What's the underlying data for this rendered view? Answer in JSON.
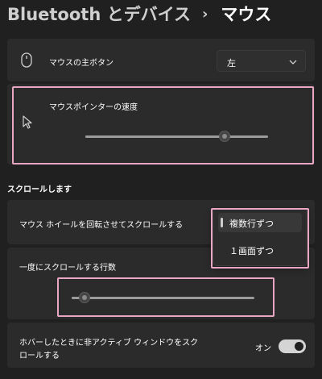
{
  "breadcrumb": {
    "root": "Bluetooth とデバイス",
    "separator": "›",
    "current": "マウス"
  },
  "primary_button": {
    "label": "マウスの主ボタン",
    "value": "左",
    "icon": "mouse-icon",
    "chevron_icon": "chevron-down-icon"
  },
  "pointer_speed": {
    "label": "マウスポインターの速度",
    "value_fraction": 0.76,
    "icon": "cursor-icon"
  },
  "scroll_section": {
    "title": "スクロールします",
    "wheel_scroll": {
      "label": "マウス ホイールを回転させてスクロールする",
      "options": [
        "複数行ずつ",
        "１画面ずつ"
      ],
      "selected": "複数行ずつ"
    },
    "lines_to_scroll": {
      "label": "一度にスクロールする行数",
      "value_fraction": 0.07
    },
    "inactive_scroll": {
      "label_line1": "ホバーしたときに非アクティブ ウィンドウをスク",
      "label_line2": "ロールする",
      "state_text": "オン",
      "on": true
    }
  },
  "colors": {
    "background": "#202020",
    "card": "#2b2b2b",
    "highlight_box": "#e9a6c3",
    "toggle_on": "#d4d4d4"
  }
}
